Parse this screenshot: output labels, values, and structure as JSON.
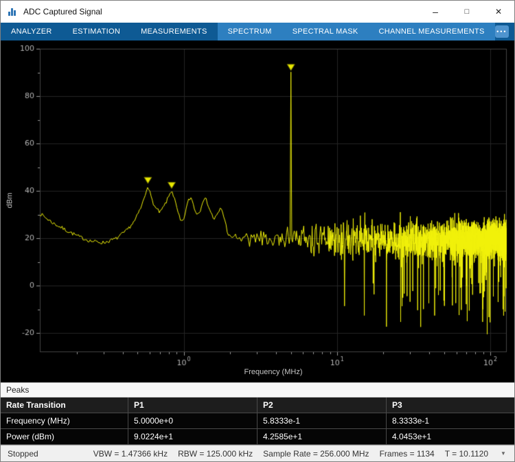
{
  "window": {
    "title": "ADC Captured Signal",
    "controls": {
      "minimize": "–",
      "maximize": "□",
      "close": "✕"
    }
  },
  "colors": {
    "toolstrip_base": "#0e5a94",
    "toolstrip_context": "#2d7fc0",
    "trace_yellow": "#f2f20a"
  },
  "toolstrip": {
    "tabs": [
      "ANALYZER",
      "ESTIMATION",
      "MEASUREMENTS"
    ],
    "contextual_tabs": [
      "SPECTRUM",
      "SPECTRAL MASK",
      "CHANNEL MEASUREMENTS"
    ],
    "overflow_glyph": "•••"
  },
  "chart_data": {
    "type": "line",
    "title": "",
    "xlabel": "Frequency (MHz)",
    "ylabel": "dBm",
    "x_scale": "log",
    "xlim": [
      0.115,
      128
    ],
    "ylim": [
      -28,
      100
    ],
    "yticks": [
      -20,
      0,
      20,
      40,
      60,
      80,
      100
    ],
    "xticks": [
      {
        "value": 1,
        "mantissa": "10",
        "exponent": "0"
      },
      {
        "value": 10,
        "mantissa": "10",
        "exponent": "1"
      },
      {
        "value": 100,
        "mantissa": "10",
        "exponent": "2"
      }
    ],
    "background": "#000000",
    "grid_color": "#262626",
    "axis_box_color": "#444444",
    "tick_color": "#9a9a9a",
    "tick_label_color": "#b4b4b4",
    "line_color": "#f2f20a",
    "marker_fill": "#e8e800",
    "marker_stroke": "#6e6e00",
    "noise_floor_dbm": 19.5,
    "seed": 7,
    "peaks": [
      {
        "label": "P1",
        "freq": 5.0,
        "power": 90.224
      },
      {
        "label": "P2",
        "freq": 0.58333,
        "power": 42.585
      },
      {
        "label": "P3",
        "freq": 0.83333,
        "power": 40.453
      }
    ],
    "smooth_profile": [
      [
        0.115,
        30.5
      ],
      [
        0.14,
        26.5
      ],
      [
        0.17,
        23.5
      ],
      [
        0.21,
        20.5
      ],
      [
        0.25,
        18.8
      ],
      [
        0.3,
        18.2
      ],
      [
        0.36,
        19.8
      ],
      [
        0.42,
        23
      ],
      [
        0.48,
        27.5
      ],
      [
        0.53,
        33.5
      ],
      [
        0.558,
        38
      ],
      [
        0.5833,
        42.8
      ],
      [
        0.61,
        37.5
      ],
      [
        0.65,
        33
      ],
      [
        0.7,
        30.8
      ],
      [
        0.75,
        34
      ],
      [
        0.79,
        37
      ],
      [
        0.8333,
        40.6
      ],
      [
        0.87,
        36.5
      ],
      [
        0.91,
        31.5
      ],
      [
        0.95,
        27.5
      ],
      [
        0.99,
        26.8
      ],
      [
        1.03,
        32
      ],
      [
        1.08,
        36.5
      ],
      [
        1.12,
        37.2
      ],
      [
        1.17,
        33
      ],
      [
        1.22,
        30
      ],
      [
        1.28,
        32
      ],
      [
        1.34,
        36.8
      ],
      [
        1.41,
        36
      ],
      [
        1.49,
        31.5
      ],
      [
        1.57,
        28
      ],
      [
        1.66,
        30
      ],
      [
        1.75,
        33
      ],
      [
        1.84,
        28.5
      ],
      [
        1.94,
        22
      ],
      [
        2.05,
        19.8
      ],
      [
        2.15,
        21.5
      ],
      [
        2.25,
        20
      ]
    ],
    "noise_segment": {
      "start": 2.25,
      "end": 128,
      "step": 0.0625
    }
  },
  "peaks_panel": {
    "title": "Peaks",
    "table": {
      "headers": [
        "Rate Transition",
        "P1",
        "P2",
        "P3"
      ],
      "rows": [
        [
          "Frequency (MHz)",
          "5.0000e+0",
          "5.8333e-1",
          "8.3333e-1"
        ],
        [
          "Power (dBm)",
          "9.0224e+1",
          "4.2585e+1",
          "4.0453e+1"
        ]
      ]
    }
  },
  "status_bar": {
    "state": "Stopped",
    "items": [
      "VBW = 1.47366 kHz",
      "RBW = 125.000 kHz",
      "Sample Rate = 256.000 MHz",
      "Frames = 1134",
      "T = 10.1120"
    ],
    "expand_glyph": "▼"
  }
}
